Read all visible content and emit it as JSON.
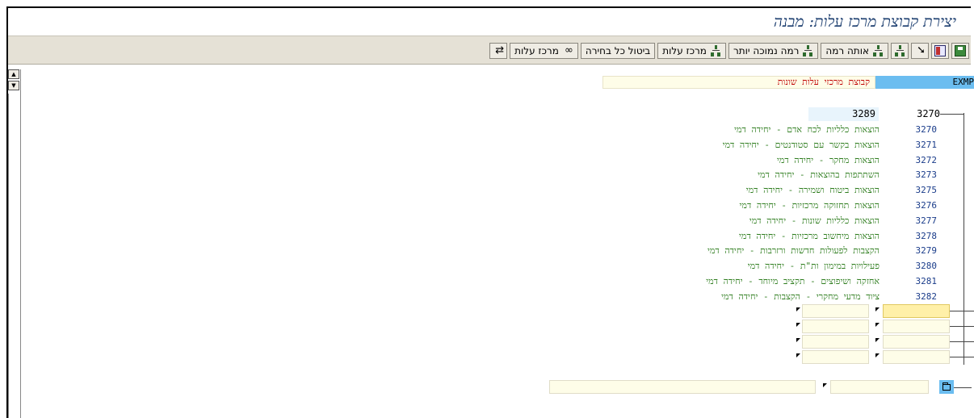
{
  "window": {
    "title": "יצירת קבוצת מרכז עלות: מבנה"
  },
  "toolbar": {
    "buttons": [
      {
        "label": "",
        "icon": "save-icon"
      },
      {
        "label": "",
        "icon": "split-screen-icon"
      },
      {
        "label": "",
        "icon": "select-arrow-icon"
      },
      {
        "label": "",
        "icon": "hierarchy-icon"
      },
      {
        "label": "אותה רמה",
        "icon": "hierarchy-icon"
      },
      {
        "label": "רמה נמוכה יותר",
        "icon": "hierarchy-icon"
      },
      {
        "label": "מרכז עלות",
        "icon": "hierarchy-icon"
      },
      {
        "label": "ביטול כל בחירה",
        "icon": ""
      },
      {
        "label": "מרכז עלות",
        "icon": "glasses-icon"
      },
      {
        "label": "",
        "icon": "swap-icon"
      }
    ]
  },
  "group": {
    "code": "EXMP",
    "name": "קבוצת מרכזי עלות שונות",
    "range_from": "3289",
    "range_to": "3270"
  },
  "cost_centers": [
    {
      "code": "3270",
      "desc": "הוצאות כלליות לכח אדם - יחידה דמי"
    },
    {
      "code": "3271",
      "desc": "הוצאות בקשר עם סטודנטים - יחידה דמי"
    },
    {
      "code": "3272",
      "desc": "הוצאות מחקר - יחידה דמי"
    },
    {
      "code": "3273",
      "desc": "השתתפות בהוצאות - יחידה דמי"
    },
    {
      "code": "3275",
      "desc": "הוצאות ביטוח ושמירה - יחידה דמי"
    },
    {
      "code": "3276",
      "desc": "הוצאות תחזוקה מרכזיות - יחידה דמי"
    },
    {
      "code": "3277",
      "desc": "הוצאות כלליות שונות - יחידה דמי"
    },
    {
      "code": "3278",
      "desc": "הוצאות מיחשוב מרכזיות - יחידה דמי"
    },
    {
      "code": "3279",
      "desc": "הקצבות לפעולות חדשות ורזרבות - יחידה דמי"
    },
    {
      "code": "3280",
      "desc": "פעילויות במימון ות\"ת - יחידה דמי"
    },
    {
      "code": "3281",
      "desc": "אחזקה ושיפוצים - תקציב מיוחד - יחידה דמי"
    },
    {
      "code": "3282",
      "desc": "ציוד מדעי מחקרי - הקצבות - יחידה דמי"
    }
  ],
  "colors": {
    "accent_blue": "#6bbdf0",
    "code_text": "#1a3c8a",
    "desc_text": "#2e7d1e",
    "name_text": "#c00000"
  }
}
